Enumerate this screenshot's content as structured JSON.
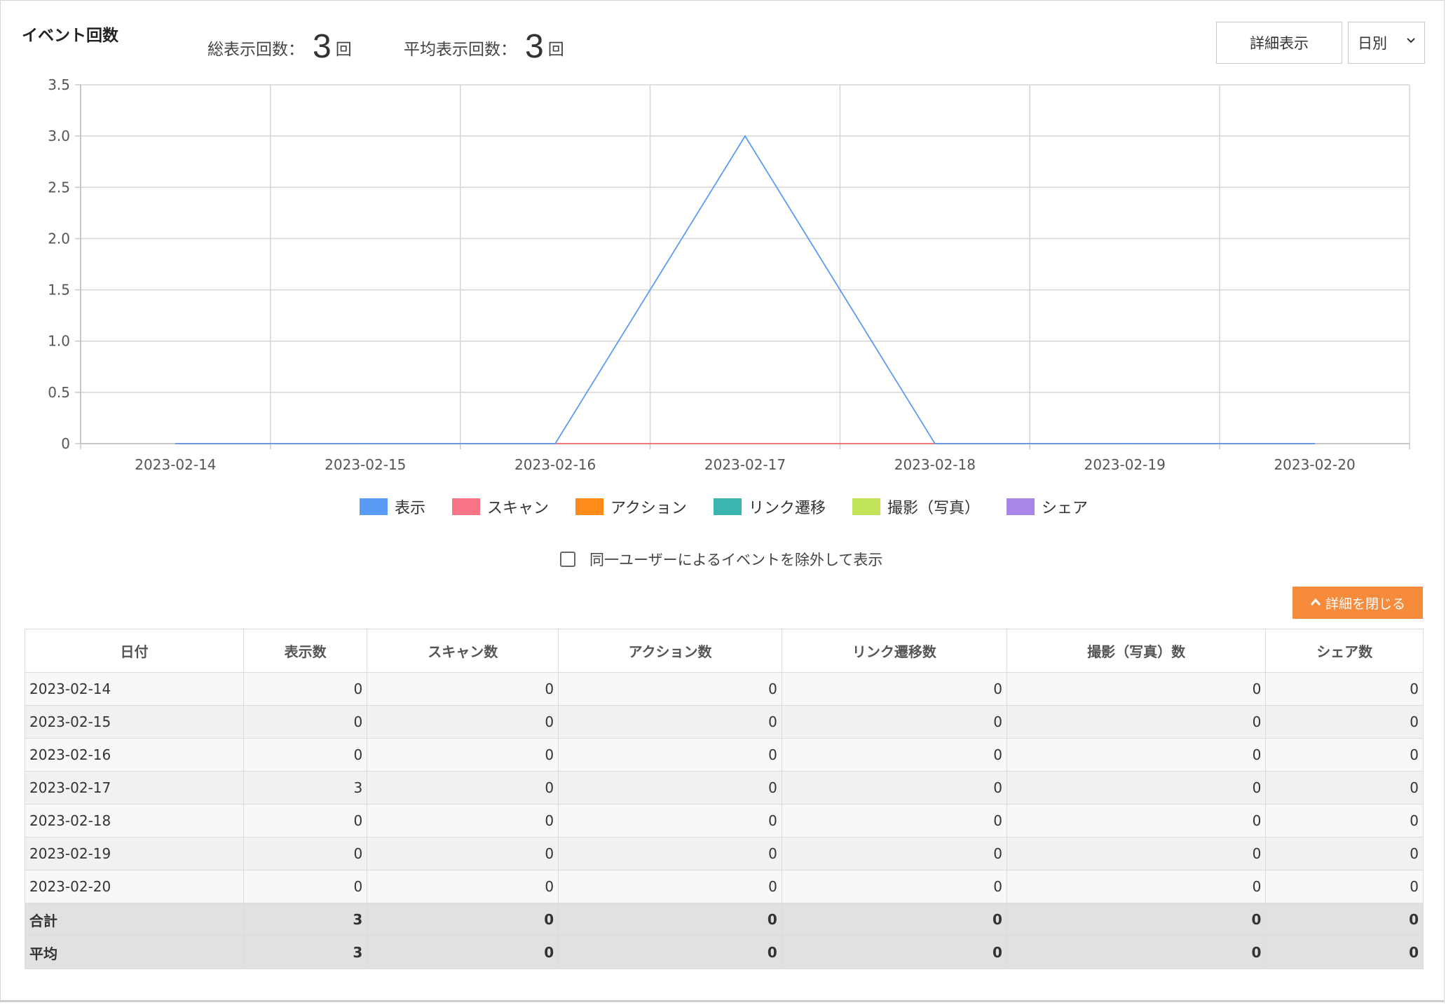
{
  "header": {
    "title": "イベント回数",
    "total_label": "総表示回数：",
    "total_value": "3",
    "total_unit": "回",
    "avg_label": "平均表示回数：",
    "avg_value": "3",
    "avg_unit": "回",
    "detail_button": "詳細表示",
    "period_select": "日別"
  },
  "chart_data": {
    "type": "line",
    "categories": [
      "2023-02-14",
      "2023-02-15",
      "2023-02-16",
      "2023-02-17",
      "2023-02-18",
      "2023-02-19",
      "2023-02-20"
    ],
    "ylim": [
      0,
      3.5
    ],
    "yticks": [
      "0",
      "0.5",
      "1.0",
      "1.5",
      "2.0",
      "2.5",
      "3.0",
      "3.5"
    ],
    "grid": true,
    "legend_position": "bottom",
    "series": [
      {
        "name": "表示",
        "color": "#5b9bf8",
        "values": [
          0,
          0,
          0,
          3,
          0,
          0,
          0
        ]
      },
      {
        "name": "スキャン",
        "color": "#f97485",
        "values": [
          0,
          0,
          0,
          0,
          0,
          0,
          0
        ]
      },
      {
        "name": "アクション",
        "color": "#ff8c1a",
        "values": [
          0,
          0,
          0,
          0,
          0,
          0,
          0
        ]
      },
      {
        "name": "リンク遷移",
        "color": "#3ab5b0",
        "values": [
          0,
          0,
          0,
          0,
          0,
          0,
          0
        ]
      },
      {
        "name": "撮影（写真）",
        "color": "#c2e45a",
        "values": [
          0,
          0,
          0,
          0,
          0,
          0,
          0
        ]
      },
      {
        "name": "シェア",
        "color": "#a987e8",
        "values": [
          0,
          0,
          0,
          0,
          0,
          0,
          0
        ]
      }
    ]
  },
  "exclude_label": "同一ユーザーによるイベントを除外して表示",
  "close_button": "詳細を閉じる",
  "table": {
    "headers": [
      "日付",
      "表示数",
      "スキャン数",
      "アクション数",
      "リンク遷移数",
      "撮影（写真）数",
      "シェア数"
    ],
    "rows": [
      [
        "2023-02-14",
        "0",
        "0",
        "0",
        "0",
        "0",
        "0"
      ],
      [
        "2023-02-15",
        "0",
        "0",
        "0",
        "0",
        "0",
        "0"
      ],
      [
        "2023-02-16",
        "0",
        "0",
        "0",
        "0",
        "0",
        "0"
      ],
      [
        "2023-02-17",
        "3",
        "0",
        "0",
        "0",
        "0",
        "0"
      ],
      [
        "2023-02-18",
        "0",
        "0",
        "0",
        "0",
        "0",
        "0"
      ],
      [
        "2023-02-19",
        "0",
        "0",
        "0",
        "0",
        "0",
        "0"
      ],
      [
        "2023-02-20",
        "0",
        "0",
        "0",
        "0",
        "0",
        "0"
      ]
    ],
    "summary": [
      [
        "合計",
        "3",
        "0",
        "0",
        "0",
        "0",
        "0"
      ],
      [
        "平均",
        "3",
        "0",
        "0",
        "0",
        "0",
        "0"
      ]
    ]
  }
}
